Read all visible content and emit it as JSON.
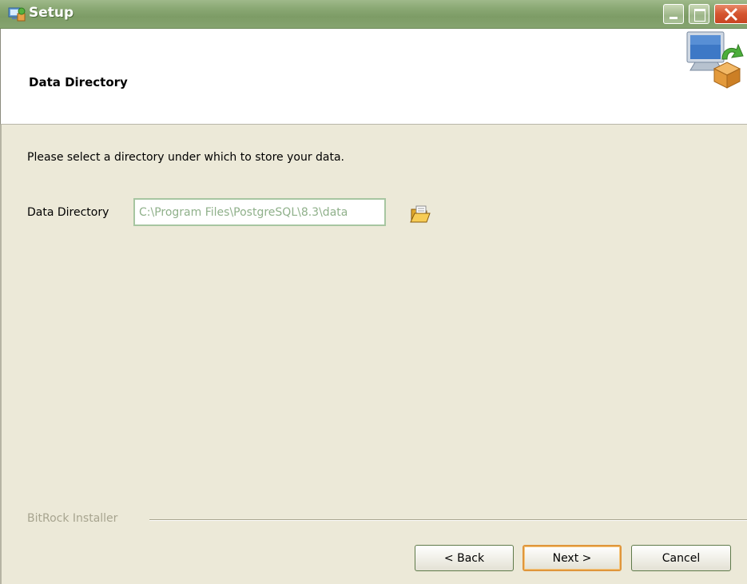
{
  "window": {
    "title": "Setup"
  },
  "header": {
    "title": "Data Directory",
    "icon": "installer-computer-box-icon"
  },
  "content": {
    "instruction": "Please select a directory under which to store your data.",
    "data_directory_label": "Data Directory",
    "data_directory_value": "C:\\Program Files\\PostgreSQL\\8.3\\data",
    "browse_icon": "folder-open-icon"
  },
  "footer": {
    "brand": "BitRock Installer",
    "back_label": "< Back",
    "next_label": "Next >",
    "cancel_label": "Cancel"
  },
  "colors": {
    "titlebar": "#8aa874",
    "window_background": "#ece9d8",
    "header_background": "#ffffff",
    "input_text": "#8fb08a",
    "default_button_border": "#e0963b"
  }
}
